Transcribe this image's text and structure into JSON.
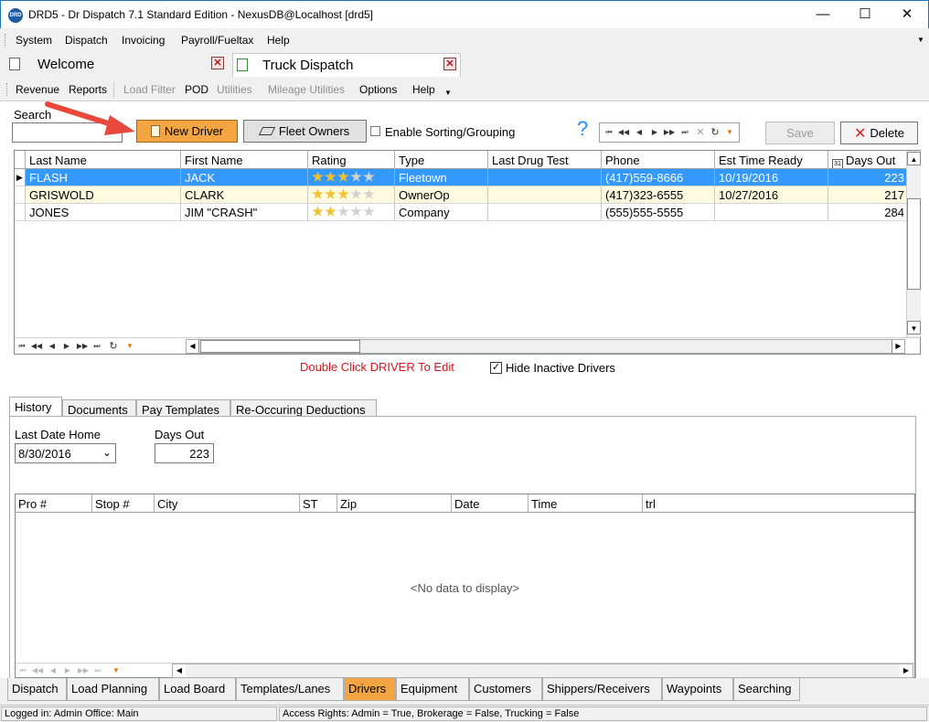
{
  "window": {
    "logo_text": "DRD",
    "title": "DRD5 - Dr Dispatch 7.1 Standard Edition - NexusDB@Localhost [drd5]",
    "minimize": "—",
    "maximize": "☐",
    "close": "✕"
  },
  "menu": [
    "System",
    "Dispatch",
    "Invoicing",
    "Payroll/Fueltax",
    "Help"
  ],
  "doc_tabs": [
    {
      "label": "Welcome",
      "close": "✕"
    },
    {
      "label": "Truck Dispatch",
      "close": "✕"
    }
  ],
  "toolbar": {
    "items": [
      {
        "label": "Revenue",
        "enabled": true
      },
      {
        "label": "Reports",
        "enabled": true
      },
      {
        "label": "Load Filter",
        "enabled": false
      },
      {
        "label": "POD",
        "enabled": true
      },
      {
        "label": "Utilities",
        "enabled": false
      },
      {
        "label": "Mileage Utilities",
        "enabled": false
      },
      {
        "label": "Options",
        "enabled": true
      },
      {
        "label": "Help",
        "enabled": true
      }
    ]
  },
  "drivers": {
    "search_label": "Search",
    "search_value": "",
    "new_driver": "New Driver",
    "fleet_owners": "Fleet Owners",
    "enable_sorting": "Enable Sorting/Grouping",
    "enable_sorting_checked": false,
    "help_glyph": "?",
    "save": "Save",
    "delete": "Delete",
    "columns": [
      "Last Name",
      "First Name",
      "Rating",
      "Type",
      "Last Drug Test",
      "Phone",
      "Est Time Ready",
      "Days Out"
    ],
    "rows": [
      {
        "last": "FLASH",
        "first": "JACK",
        "rating": 3,
        "type": "Fleetown",
        "drug": "",
        "phone": "(417)559-8666",
        "ready": "10/19/2016",
        "days": "223",
        "selected": true
      },
      {
        "last": "GRISWOLD",
        "first": "CLARK",
        "rating": 3,
        "type": "OwnerOp",
        "drug": "",
        "phone": "(417)323-6555",
        "ready": "10/27/2016",
        "days": "217",
        "selected": false
      },
      {
        "last": "JONES",
        "first": "JIM \"CRASH\"",
        "rating": 2,
        "type": "Company",
        "drug": "",
        "phone": "(555)555-5555",
        "ready": "",
        "days": "284",
        "selected": false
      }
    ],
    "max_rating": 5,
    "hint": "Double Click DRIVER To Edit",
    "hide_inactive": "Hide Inactive Drivers",
    "hide_inactive_checked": true
  },
  "detail": {
    "tabs": [
      "History",
      "Documents",
      "Pay Templates",
      "Re-Occuring Deductions"
    ],
    "active_tab": "History",
    "last_date_home_label": "Last Date Home",
    "last_date_home": "8/30/2016",
    "days_out_label": "Days Out",
    "days_out": "223",
    "history_columns": [
      "Pro #",
      "Stop #",
      "City",
      "ST",
      "Zip",
      "Date",
      "Time",
      "trl"
    ],
    "empty_text": "<No data to display>"
  },
  "bottom_tabs": [
    "Dispatch",
    "Load Planning",
    "Load Board",
    "Templates/Lanes",
    "Drivers",
    "Equipment",
    "Customers",
    "Shippers/Receivers",
    "Waypoints",
    "Searching"
  ],
  "active_bottom_tab": "Drivers",
  "status": {
    "login": "Logged in: Admin Office: Main",
    "rights": "Access Rights: Admin = True, Brokerage = False, Trucking = False"
  },
  "colors": {
    "accent_orange": "#f3a541",
    "selected_row": "#3399ff",
    "alt_row": "#fffbe0",
    "hint_red": "#e0141e",
    "arrow_red": "#e8493a",
    "help_blue": "#1e90ff"
  }
}
